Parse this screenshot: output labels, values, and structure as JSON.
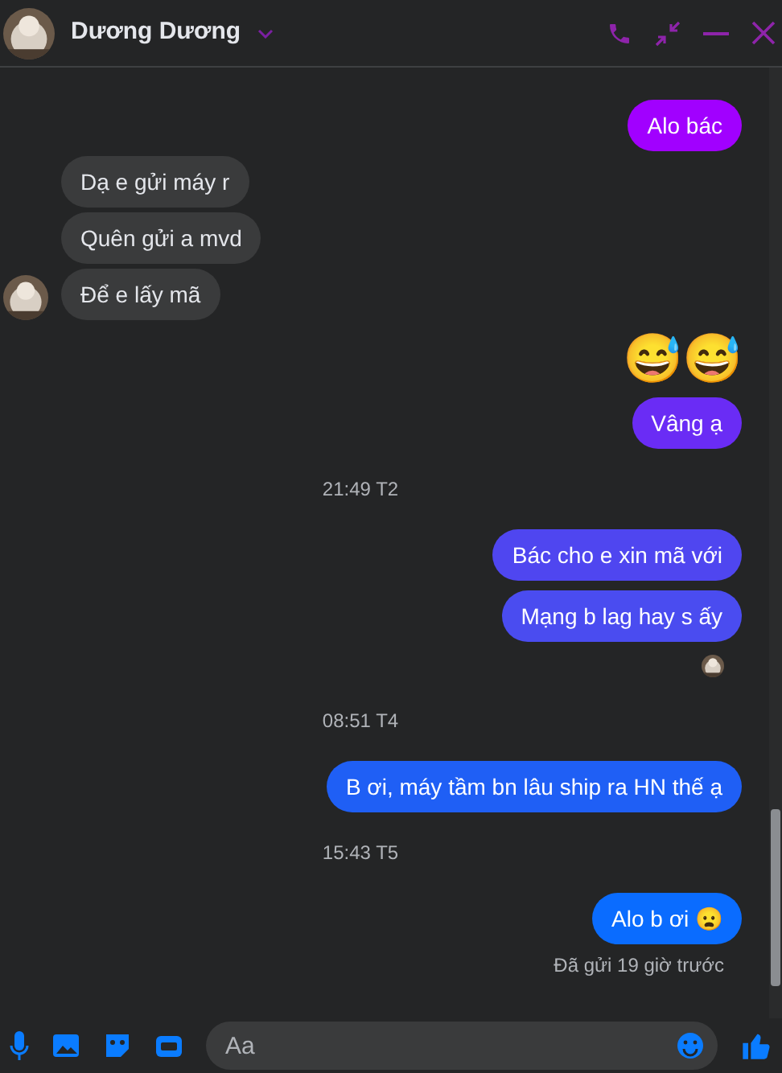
{
  "header": {
    "name": "Dương Dương"
  },
  "messages": [
    {
      "kind": "out",
      "text": "Alo bác",
      "color": "#a100ff"
    },
    {
      "kind": "in",
      "text": "Dạ e gửi máy r",
      "avatar": false
    },
    {
      "kind": "in",
      "text": "Quên gửi a mvd",
      "avatar": false
    },
    {
      "kind": "in",
      "text": "Để e lấy mã",
      "avatar": true
    },
    {
      "kind": "emoji",
      "text": "😅😅"
    },
    {
      "kind": "out",
      "text": "Vâng ạ",
      "color": "#6a2cf5"
    },
    {
      "kind": "time",
      "text": "21:49 T2"
    },
    {
      "kind": "out",
      "text": "Bác cho e xin mã với",
      "color": "#4f46f0"
    },
    {
      "kind": "out",
      "text": "Mạng b lag hay s ấy",
      "color": "#4a4cf0"
    },
    {
      "kind": "seen"
    },
    {
      "kind": "time",
      "text": "08:51 T4"
    },
    {
      "kind": "out",
      "text": "B ơi, máy tầm bn lâu ship ra HN thế ạ",
      "color": "#1f5ff5"
    },
    {
      "kind": "time",
      "text": "15:43 T5"
    },
    {
      "kind": "out",
      "text": "Alo b ơi 😦",
      "color": "#0a6cff"
    },
    {
      "kind": "status",
      "text": "Đã gửi 19 giờ trước"
    }
  ],
  "composer": {
    "placeholder": "Aa"
  }
}
